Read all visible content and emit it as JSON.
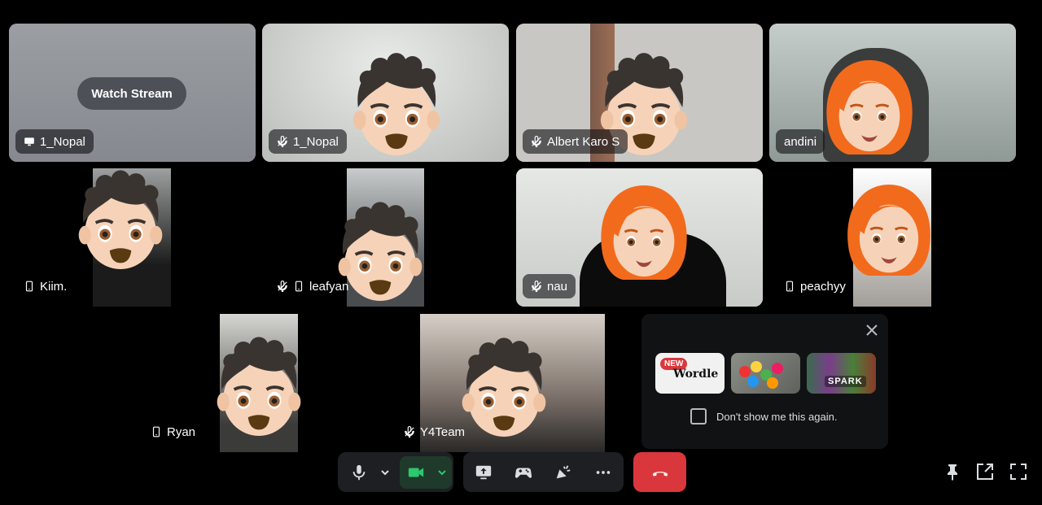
{
  "stream_tile": {
    "button": "Watch Stream",
    "name": "1_Nopal"
  },
  "tiles": [
    {
      "name": "1_Nopal"
    },
    {
      "name": "Albert Karo S"
    },
    {
      "name": "andini"
    },
    {
      "name": "Kiim."
    },
    {
      "name": "leafyan"
    },
    {
      "name": "nau"
    },
    {
      "name": "peachyy"
    },
    {
      "name": "Ryan"
    },
    {
      "name": "Y4Team"
    }
  ],
  "popup": {
    "checkbox_label": "Don't show me this again.",
    "games": [
      {
        "badge": "NEW",
        "title": "Wordle"
      },
      {
        "badge": "",
        "title": ""
      },
      {
        "badge": "",
        "title": "SPARK"
      }
    ]
  },
  "colors": {
    "accent_green": "#248046",
    "hangup_red": "#da373c",
    "panel": "#1e1f22"
  },
  "icons": [
    "screen-share-icon",
    "mute-icon",
    "mobile-icon",
    "mic-icon",
    "chevron-down-icon",
    "camera-icon",
    "screen-share-start-icon",
    "activity-icon",
    "soundboard-icon",
    "more-icon",
    "hangup-icon",
    "pin-icon",
    "popout-icon",
    "fullscreen-icon",
    "close-icon"
  ]
}
